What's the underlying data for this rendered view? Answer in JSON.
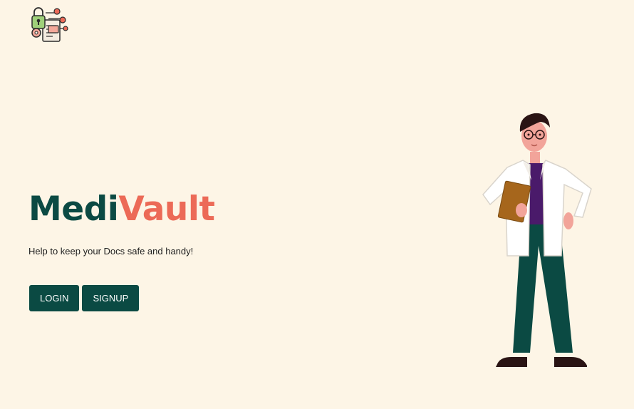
{
  "brand": {
    "name_part1": "Medi",
    "name_part2": "Vault",
    "tagline": "Help to keep your Docs safe and handy!"
  },
  "actions": {
    "login_label": "LOGIN",
    "signup_label": "SIGNUP"
  },
  "icons": {
    "logo": "medical-vault-logo-icon",
    "illustration": "doctor-with-clipboard-illustration"
  },
  "colors": {
    "background": "#fdf5e6",
    "brand_primary": "#0b4a43",
    "brand_accent": "#ec6a57",
    "button_text": "#ffffff"
  }
}
